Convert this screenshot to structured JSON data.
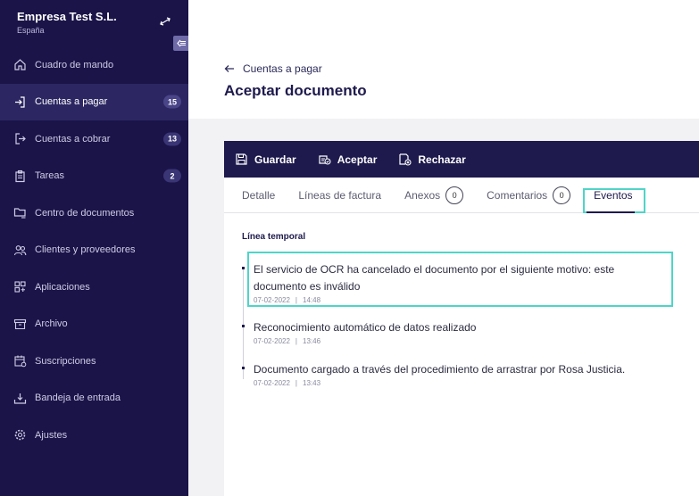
{
  "sidebar": {
    "company_name": "Empresa Test S.L.",
    "company_country": "España",
    "items": [
      {
        "label": "Cuadro de mando",
        "icon": "home-icon",
        "badge": ""
      },
      {
        "label": "Cuentas a pagar",
        "icon": "login-icon",
        "badge": "15",
        "active": true
      },
      {
        "label": "Cuentas a cobrar",
        "icon": "logout-icon",
        "badge": "13"
      },
      {
        "label": "Tareas",
        "icon": "clipboard-icon",
        "badge": "2"
      },
      {
        "label": "Centro de documentos",
        "icon": "folder-tree-icon",
        "badge": ""
      },
      {
        "label": "Clientes y proveedores",
        "icon": "users-icon",
        "badge": ""
      },
      {
        "label": "Aplicaciones",
        "icon": "apps-icon",
        "badge": ""
      },
      {
        "label": "Archivo",
        "icon": "archive-icon",
        "badge": ""
      },
      {
        "label": "Suscripciones",
        "icon": "calendar-icon",
        "badge": ""
      },
      {
        "label": "Bandeja de entrada",
        "icon": "inbox-icon",
        "badge": ""
      },
      {
        "label": "Ajustes",
        "icon": "gear-icon",
        "badge": ""
      }
    ]
  },
  "header": {
    "back_label": "Cuentas a pagar",
    "title": "Aceptar documento"
  },
  "toolbar": {
    "save_label": "Guardar",
    "accept_label": "Aceptar",
    "reject_label": "Rechazar"
  },
  "tabs": {
    "detail": "Detalle",
    "lines": "Líneas de factura",
    "attachments": "Anexos",
    "attachments_count": "0",
    "comments": "Comentarios",
    "comments_count": "0",
    "events": "Eventos"
  },
  "timeline": {
    "label": "Línea temporal",
    "events": [
      {
        "text": "El servicio de OCR ha cancelado el documento por el siguiente motivo: este documento es inválido",
        "date": "07-02-2022",
        "time": "14:48"
      },
      {
        "text": "Reconocimiento automático de datos realizado",
        "date": "07-02-2022",
        "time": "13:46"
      },
      {
        "text": "Documento cargado a través del procedimiento de arrastrar por Rosa Justicia.",
        "date": "07-02-2022",
        "time": "13:43"
      }
    ]
  },
  "colors": {
    "sidebar_bg": "#1a1448",
    "accent": "#1e1a4d",
    "highlight": "#4fd4c8"
  }
}
